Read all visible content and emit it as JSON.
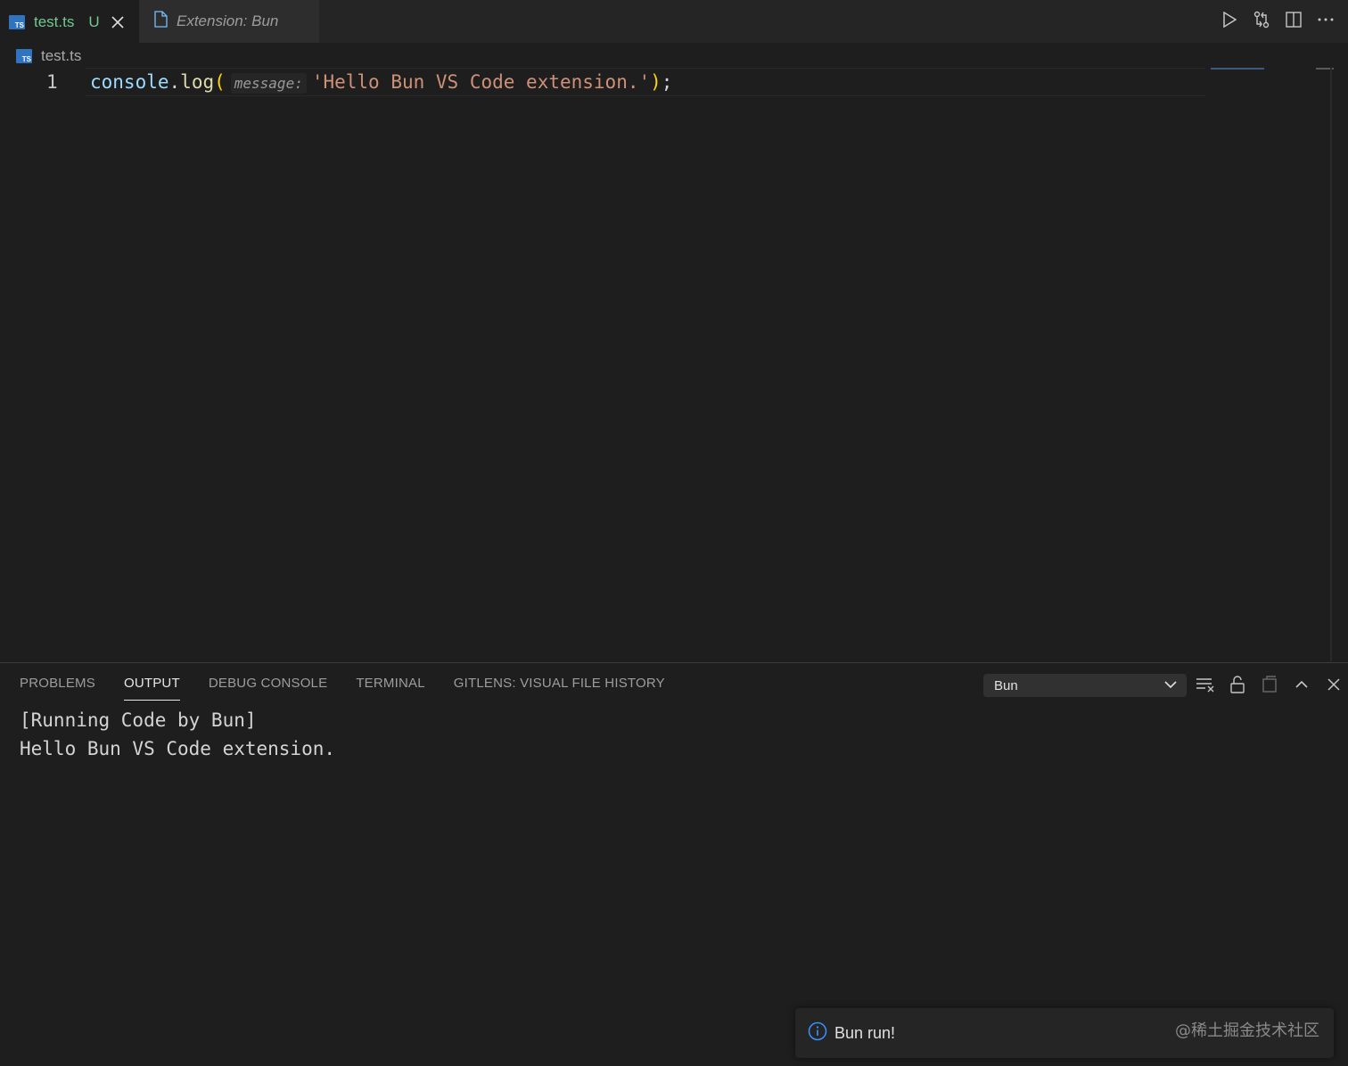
{
  "tabs": [
    {
      "label": "test.ts",
      "badge": "U",
      "icon": "ts-file-icon",
      "language_badge": "TS"
    },
    {
      "label": "Extension: Bun",
      "icon": "file-icon"
    }
  ],
  "toolbar": {
    "icons": [
      "run-icon",
      "compare-changes-icon",
      "split-editor-icon",
      "more-actions-icon"
    ]
  },
  "breadcrumb": {
    "file": "test.ts",
    "language_badge": "TS"
  },
  "editor": {
    "line_number": "1",
    "tokens": {
      "obj": "console",
      "dot": ".",
      "fn": "log",
      "open_paren": "(",
      "inlay_hint": "message:",
      "string": "'Hello Bun VS Code extension.'",
      "close_paren": ")",
      "semicolon": ";"
    }
  },
  "panel": {
    "tabs": [
      "PROBLEMS",
      "OUTPUT",
      "DEBUG CONSOLE",
      "TERMINAL",
      "GITLENS: VISUAL FILE HISTORY"
    ],
    "active_tab": "OUTPUT",
    "output_channel": "Bun",
    "output_lines": [
      "[Running Code by Bun]",
      "Hello Bun VS Code extension."
    ]
  },
  "notification": {
    "icon": "info-icon",
    "message": "Bun run!"
  },
  "watermark": "@稀土掘金技术社区",
  "colors": {
    "accent": "#73c991",
    "ts_badge": "#2f74c0",
    "info": "#3794ff"
  }
}
